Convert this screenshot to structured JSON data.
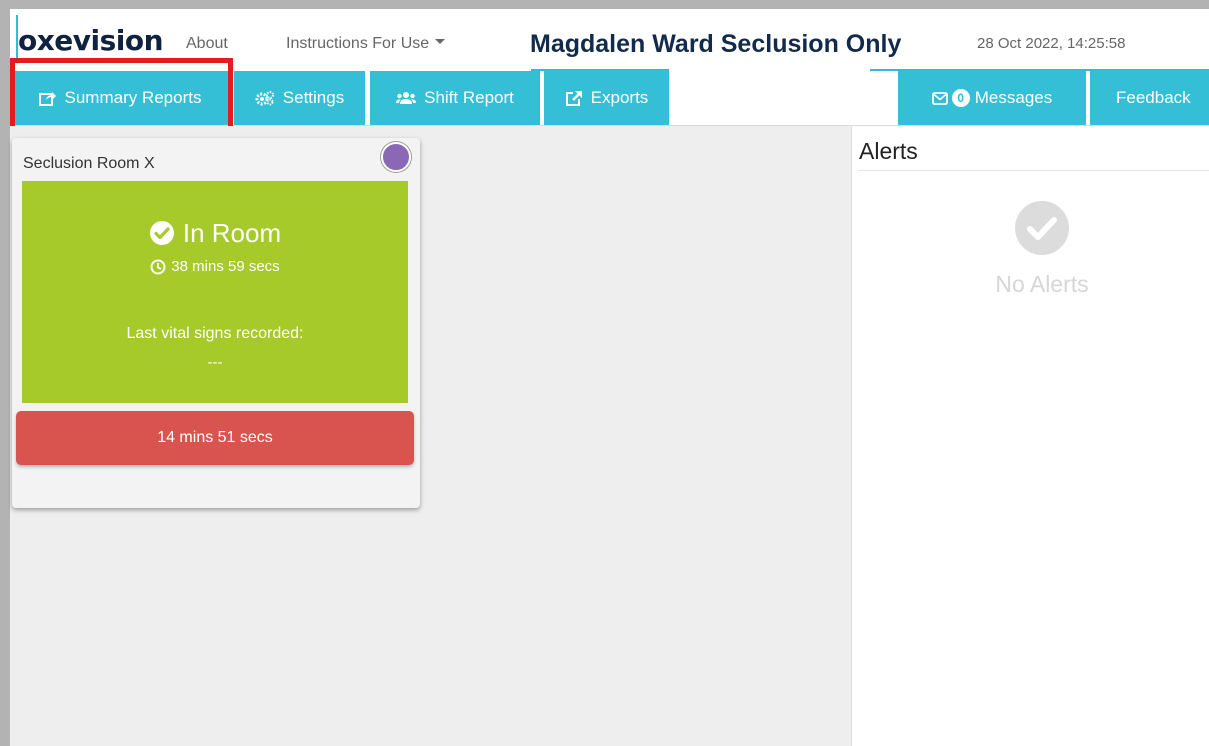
{
  "header": {
    "logo_text": "oxevision",
    "about_label": "About",
    "instructions_label": "Instructions For Use",
    "ward_title": "Magdalen Ward Seclusion Only",
    "datetime": "28 Oct 2022, 14:25:58"
  },
  "nav": {
    "summary_reports": "Summary Reports",
    "settings": "Settings",
    "shift_report": "Shift Report",
    "exports": "Exports",
    "messages_count": "0",
    "messages": "Messages",
    "feedback": "Feedback"
  },
  "room_card": {
    "room_name": "Seclusion Room X",
    "status": "In Room",
    "duration": "38 mins 59 secs",
    "vitals_label": "Last vital signs recorded:",
    "vitals_value": "---",
    "timer": "14 mins 51 secs"
  },
  "alerts": {
    "title": "Alerts",
    "empty_text": "No Alerts"
  },
  "colors": {
    "accent": "#34bfd6",
    "status_green": "#a5ca2a",
    "timer_red": "#d9534f",
    "status_dot_purple": "#8b68b5",
    "highlight_red": "#e31b23"
  },
  "icons": {
    "summary_reports": "share-square-icon",
    "settings": "cogs-icon",
    "shift_report": "users-icon",
    "exports": "external-link-icon",
    "messages": "envelope-icon",
    "status": "check-circle-icon",
    "duration": "clock-icon",
    "no_alerts": "check-circle-icon"
  }
}
